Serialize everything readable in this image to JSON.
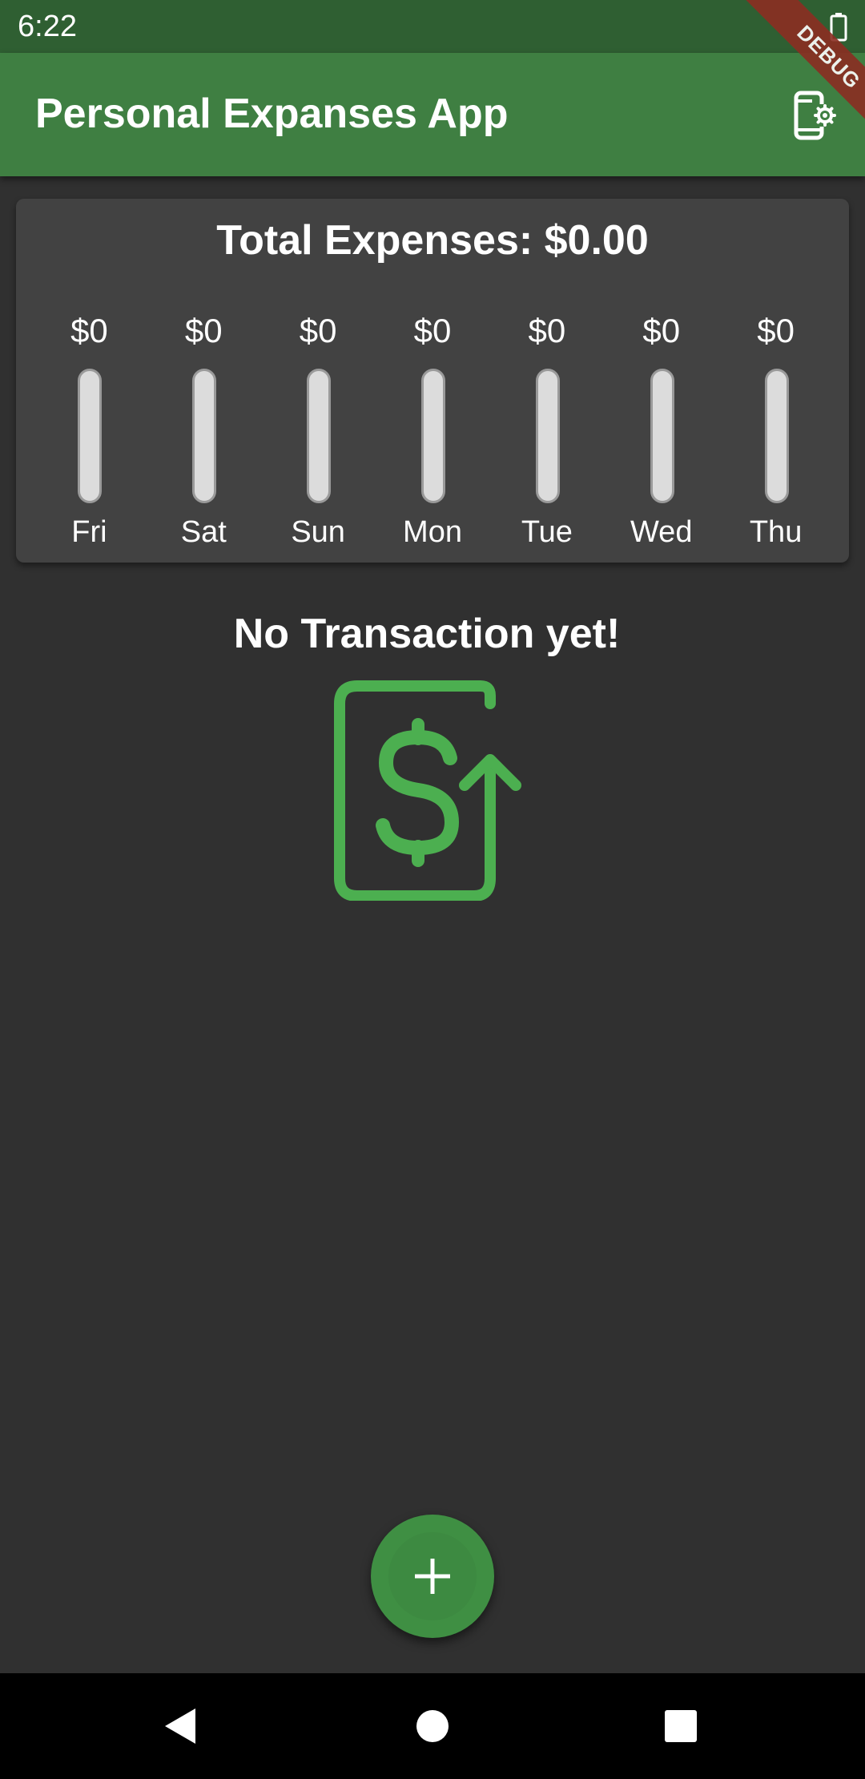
{
  "status_bar": {
    "time": "6:22",
    "battery_icon": "battery-icon"
  },
  "app_bar": {
    "title": "Personal Expanses App",
    "action_icon": "phone-settings-icon",
    "debug_banner": "DEBUG"
  },
  "chart": {
    "title": "Total Expenses: $0.00",
    "days": [
      {
        "day": "Fri",
        "amount": "$0"
      },
      {
        "day": "Sat",
        "amount": "$0"
      },
      {
        "day": "Sun",
        "amount": "$0"
      },
      {
        "day": "Mon",
        "amount": "$0"
      },
      {
        "day": "Tue",
        "amount": "$0"
      },
      {
        "day": "Wed",
        "amount": "$0"
      },
      {
        "day": "Thu",
        "amount": "$0"
      }
    ]
  },
  "chart_data": {
    "type": "bar",
    "title": "Total Expenses: $0.00",
    "categories": [
      "Fri",
      "Sat",
      "Sun",
      "Mon",
      "Tue",
      "Wed",
      "Thu"
    ],
    "values": [
      0,
      0,
      0,
      0,
      0,
      0,
      0
    ],
    "fill_fraction": [
      0,
      0,
      0,
      0,
      0,
      0,
      0
    ],
    "xlabel": "",
    "ylabel": ""
  },
  "empty_state": {
    "message": "No Transaction yet!",
    "icon": "money-receipt-icon"
  },
  "fab": {
    "icon": "plus-icon"
  },
  "nav": {
    "back_icon": "back-icon",
    "home_icon": "home-icon",
    "recents_icon": "recents-icon"
  },
  "colors": {
    "background": "#303030",
    "app_bar": "#3f7f42",
    "status_bar": "#2f5f32",
    "card": "#424242",
    "accent": "#4caf50",
    "fab": "#3f8f43"
  }
}
